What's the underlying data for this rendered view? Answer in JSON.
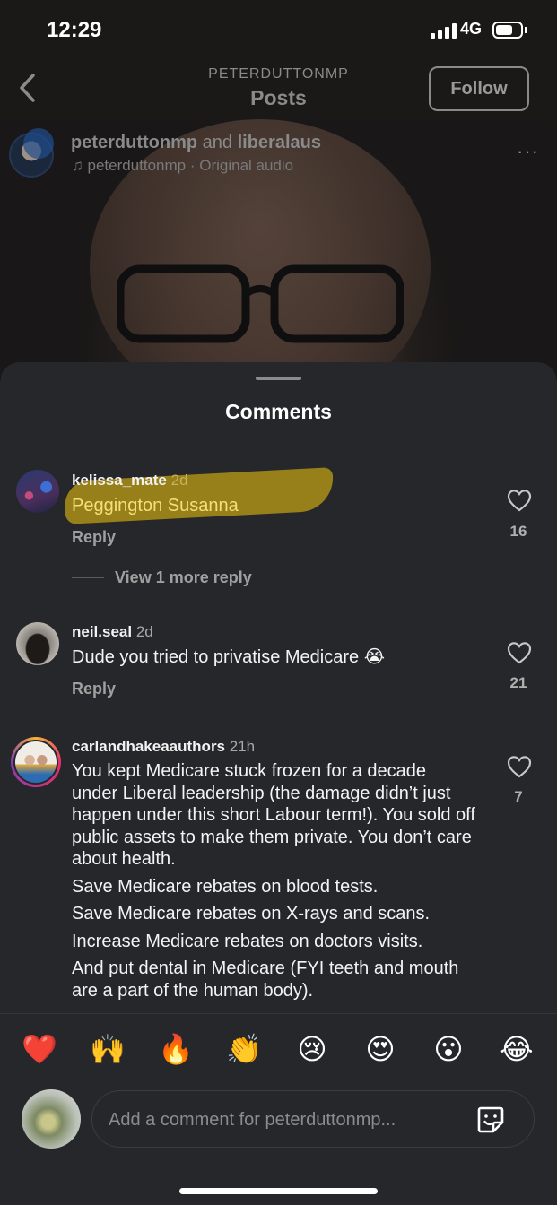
{
  "status_bar": {
    "time": "12:29",
    "network": "4G"
  },
  "nav": {
    "subtitle": "PETERDUTTONMP",
    "title": "Posts",
    "follow_label": "Follow"
  },
  "post": {
    "user1": "peterduttonmp",
    "and": " and ",
    "user2": "liberalaus",
    "audio": "peterduttonmp · Original audio",
    "more": "···"
  },
  "sheet": {
    "title": "Comments"
  },
  "comments": [
    {
      "username": "kelissa_mate",
      "age": "2d",
      "text": "Peggington Susanna",
      "reply": "Reply",
      "likes": "16",
      "view_more": "View 1 more reply"
    },
    {
      "username": "neil.seal",
      "age": "2d",
      "text": "Dude you tried to privatise Medicare 😭",
      "reply": "Reply",
      "likes": "21"
    },
    {
      "username": "carlandhakeaauthors",
      "age": "21h",
      "paragraphs": [
        "You kept Medicare stuck frozen for a decade under Liberal leadership (the damage didn’t just happen under this short Labour term!). You sold off public assets to make them private. You don’t care about health.",
        "Save Medicare rebates on blood tests.",
        "Save Medicare rebates on X-rays and scans.",
        "Increase Medicare rebates on doctors visits.",
        "And put dental in Medicare (FYI teeth and mouth are a part of the human body)."
      ],
      "likes": "7"
    }
  ],
  "reactions": [
    "❤️",
    "🙌",
    "🔥",
    "👏",
    "😢",
    "😍",
    "😮",
    "😂"
  ],
  "composer": {
    "placeholder": "Add a comment for peterduttonmp..."
  },
  "colors": {
    "sheet_bg": "#25272b",
    "highlight": "#c4a214"
  }
}
